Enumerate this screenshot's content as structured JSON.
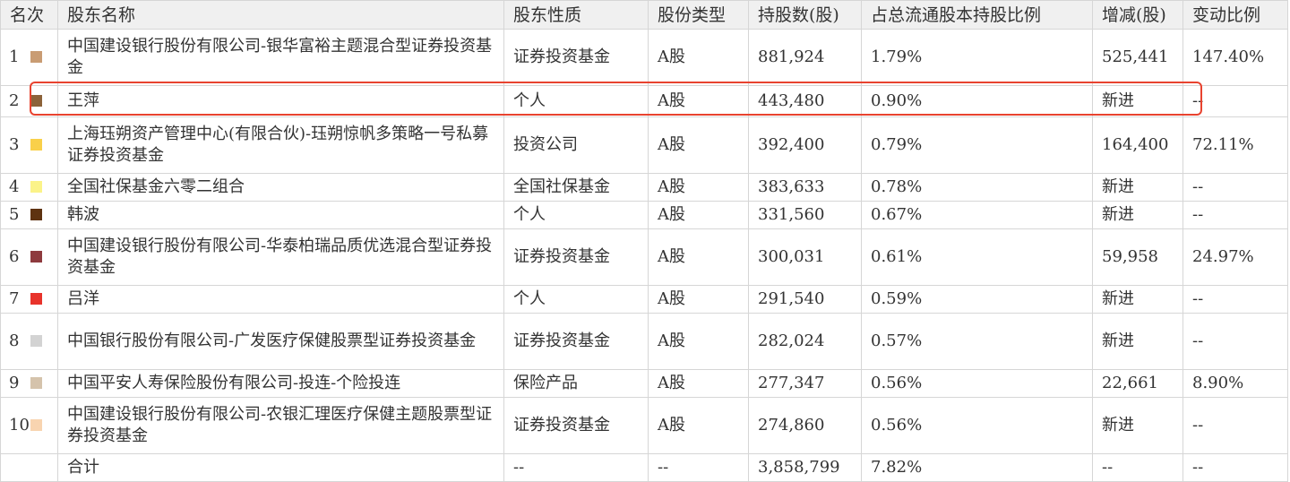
{
  "headers": {
    "rank": "名次",
    "name": "股东名称",
    "nature": "股东性质",
    "share_type": "股份类型",
    "shares": "持股数(股)",
    "ratio": "占总流通股本持股比例",
    "change": "增减(股)",
    "change_ratio": "变动比例"
  },
  "rows": [
    {
      "rank": "1",
      "color": "#c99c73",
      "name": "中国建设银行股份有限公司-银华富裕主题混合型证券投资基金",
      "nature": "证券投资基金",
      "share_type": "A股",
      "shares": "881,924",
      "ratio": "1.79%",
      "change": "525,441",
      "change_ratio": "147.40%"
    },
    {
      "rank": "2",
      "color": "#8c6239",
      "name": "王萍",
      "nature": "个人",
      "share_type": "A股",
      "shares": "443,480",
      "ratio": "0.90%",
      "change": "新进",
      "change_ratio": "--"
    },
    {
      "rank": "3",
      "color": "#f9d04a",
      "name": "上海珏朔资产管理中心(有限合伙)-珏朔惊帆多策略一号私募证券投资基金",
      "nature": "投资公司",
      "share_type": "A股",
      "shares": "392,400",
      "ratio": "0.79%",
      "change": "164,400",
      "change_ratio": "72.11%"
    },
    {
      "rank": "4",
      "color": "#fbf389",
      "name": "全国社保基金六零二组合",
      "nature": "全国社保基金",
      "share_type": "A股",
      "shares": "383,633",
      "ratio": "0.78%",
      "change": "新进",
      "change_ratio": "--"
    },
    {
      "rank": "5",
      "color": "#5e3311",
      "name": "韩波",
      "nature": "个人",
      "share_type": "A股",
      "shares": "331,560",
      "ratio": "0.67%",
      "change": "新进",
      "change_ratio": "--"
    },
    {
      "rank": "6",
      "color": "#8e3a3e",
      "name": "中国建设银行股份有限公司-华泰柏瑞品质优选混合型证券投资基金",
      "nature": "证券投资基金",
      "share_type": "A股",
      "shares": "300,031",
      "ratio": "0.61%",
      "change": "59,958",
      "change_ratio": "24.97%"
    },
    {
      "rank": "7",
      "color": "#e8332b",
      "name": "吕洋",
      "nature": "个人",
      "share_type": "A股",
      "shares": "291,540",
      "ratio": "0.59%",
      "change": "新进",
      "change_ratio": "--"
    },
    {
      "rank": "8",
      "color": "#d3d3d3",
      "name": "中国银行股份有限公司-广发医疗保健股票型证券投资基金",
      "nature": "证券投资基金",
      "share_type": "A股",
      "shares": "282,024",
      "ratio": "0.57%",
      "change": "新进",
      "change_ratio": "--"
    },
    {
      "rank": "9",
      "color": "#d5c3ac",
      "name": "中国平安人寿保险股份有限公司-投连-个险投连",
      "nature": "保险产品",
      "share_type": "A股",
      "shares": "277,347",
      "ratio": "0.56%",
      "change": "22,661",
      "change_ratio": "8.90%"
    },
    {
      "rank": "10",
      "color": "#f8d4b0",
      "name": "中国建设银行股份有限公司-农银汇理医疗保健主题股票型证券投资基金",
      "nature": "证券投资基金",
      "share_type": "A股",
      "shares": "274,860",
      "ratio": "0.56%",
      "change": "新进",
      "change_ratio": "--"
    }
  ],
  "total": {
    "label": "合计",
    "nature": "--",
    "share_type": "--",
    "shares": "3,858,799",
    "ratio": "7.82%",
    "change": "--",
    "change_ratio": "--"
  },
  "highlight_color": "#e8432f"
}
